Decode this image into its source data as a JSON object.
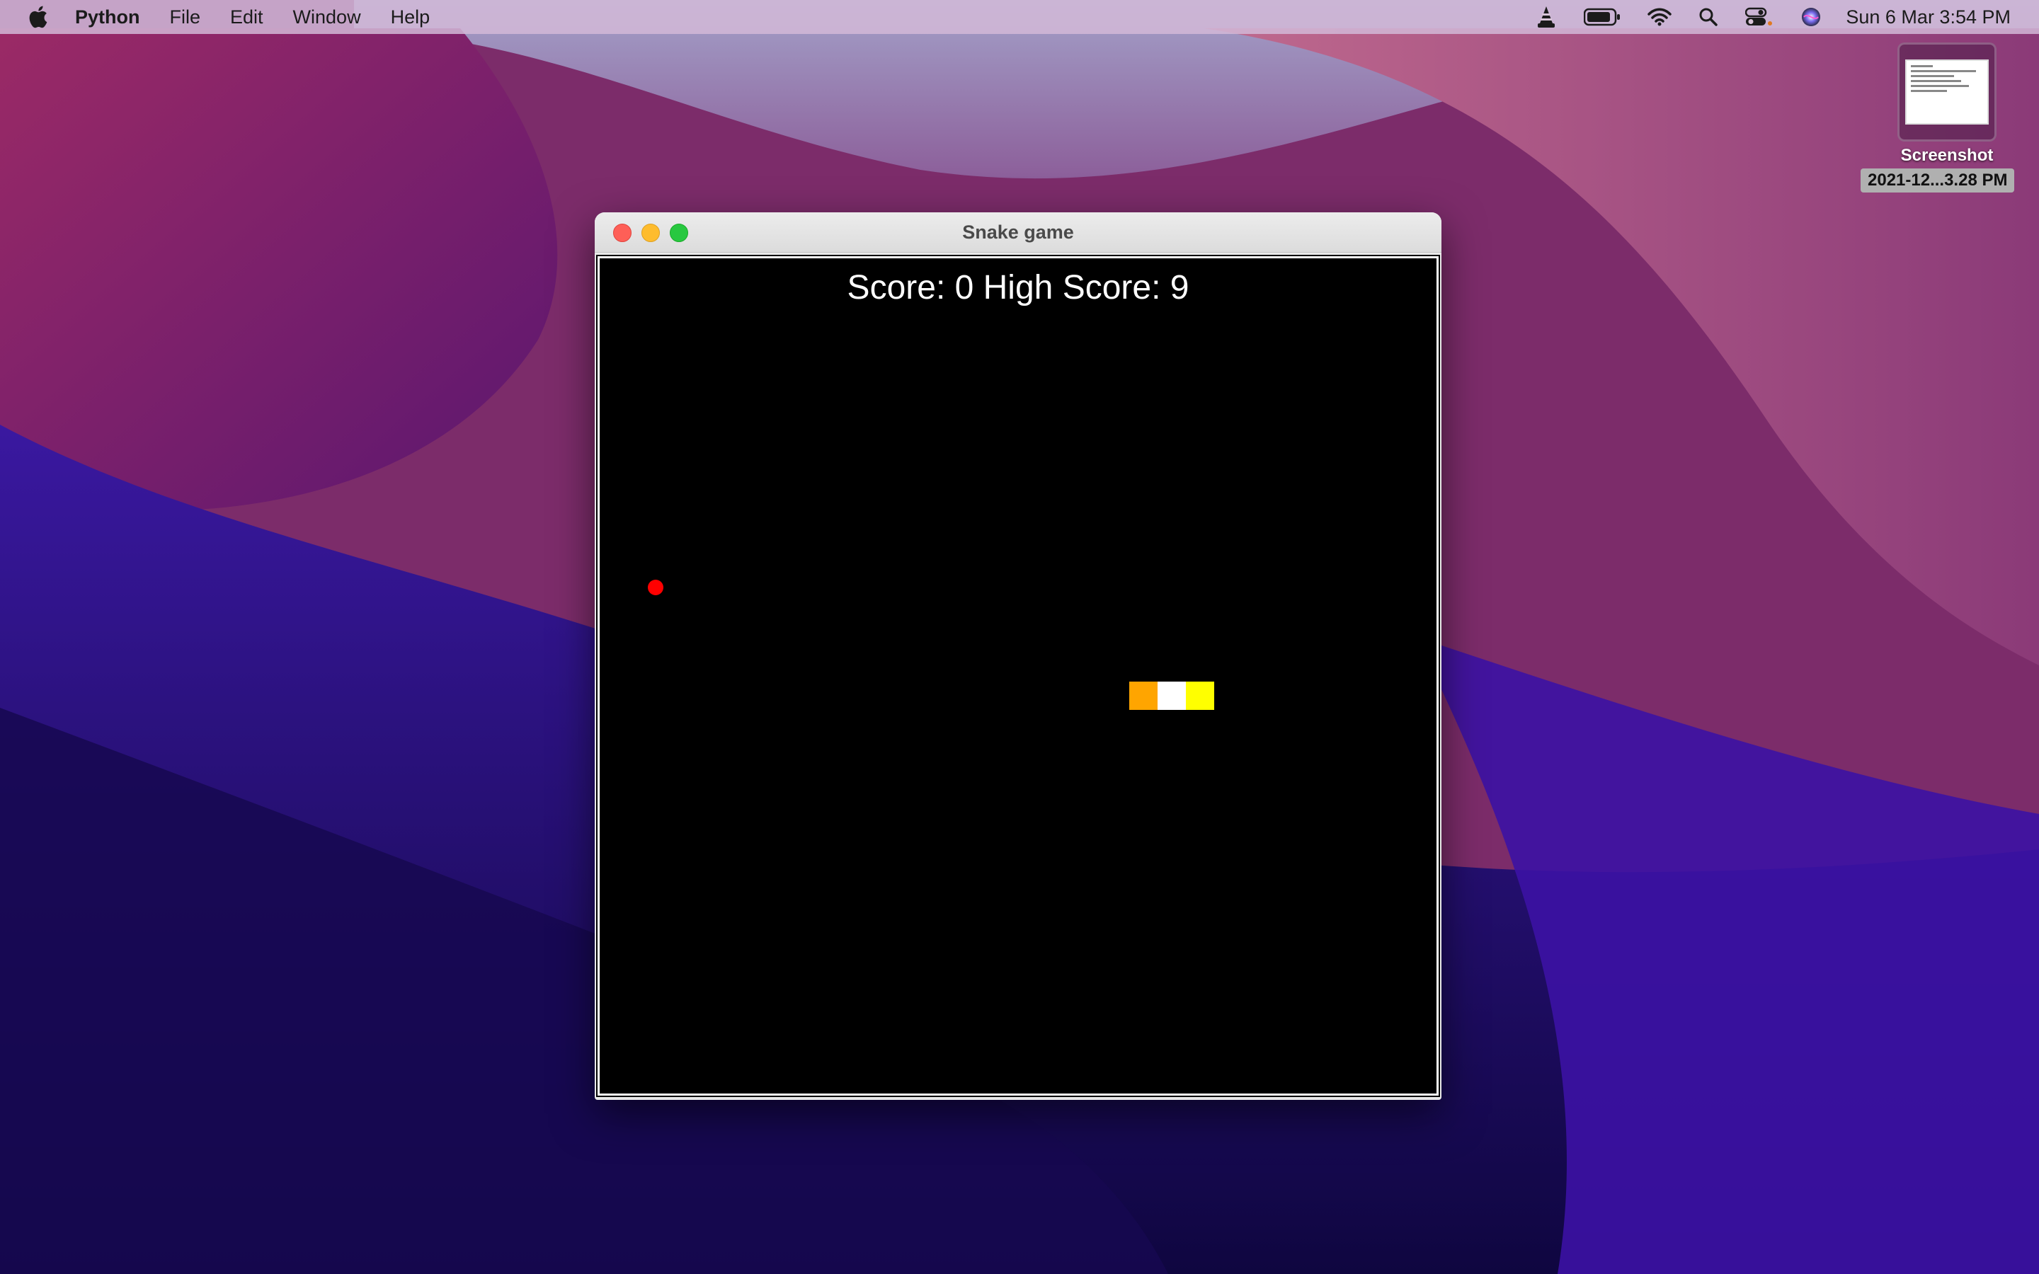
{
  "menubar": {
    "app_name": "Python",
    "items": [
      "File",
      "Edit",
      "Window",
      "Help"
    ],
    "clock": "Sun 6 Mar  3:54 PM",
    "icons": [
      "apple-icon",
      "vlc-icon",
      "battery-icon",
      "wifi-icon",
      "search-icon",
      "control-center-icon",
      "siri-icon"
    ]
  },
  "desktop": {
    "file_name_line1": "Screenshot",
    "file_name_line2": "2021-12...3.28 PM"
  },
  "window": {
    "title": "Snake game",
    "score_text": "Score: 0 High Score: 9"
  },
  "game": {
    "food_color": "#ff0000",
    "snake_colors": [
      "#ffa500",
      "#ffffff",
      "#ffff00"
    ],
    "background": "#000000"
  }
}
